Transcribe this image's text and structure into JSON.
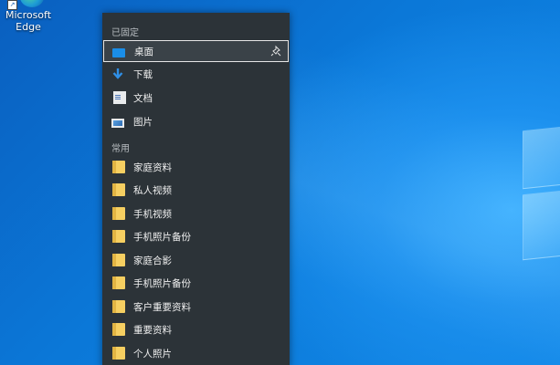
{
  "desktop": {
    "icons": [
      {
        "label_line1": "Microsoft",
        "label_line2": "Edge",
        "icon": "edge-icon"
      }
    ]
  },
  "jumplist": {
    "pinned_title": "已固定",
    "pinned": [
      {
        "label": "桌面",
        "icon": "desktop-folder-icon",
        "selected": true
      },
      {
        "label": "下载",
        "icon": "download-icon"
      },
      {
        "label": "文档",
        "icon": "document-icon"
      },
      {
        "label": "图片",
        "icon": "pictures-icon"
      }
    ],
    "frequent_title": "常用",
    "frequent": [
      {
        "label": "家庭资料",
        "icon": "folder-icon"
      },
      {
        "label": "私人视频",
        "icon": "folder-icon"
      },
      {
        "label": "手机视频",
        "icon": "folder-icon"
      },
      {
        "label": "手机照片备份",
        "icon": "folder-icon"
      },
      {
        "label": "家庭合影",
        "icon": "folder-icon"
      },
      {
        "label": "手机照片备份",
        "icon": "folder-icon"
      },
      {
        "label": "客户重要资料",
        "icon": "folder-icon"
      },
      {
        "label": "重要资料",
        "icon": "folder-icon"
      },
      {
        "label": "个人照片",
        "icon": "folder-icon"
      }
    ],
    "unpin_icon": "unpin-icon"
  },
  "colors": {
    "panel_bg": "#2c3338",
    "folder_yellow": "#f6cf61",
    "accent_blue": "#1a8ee8"
  }
}
